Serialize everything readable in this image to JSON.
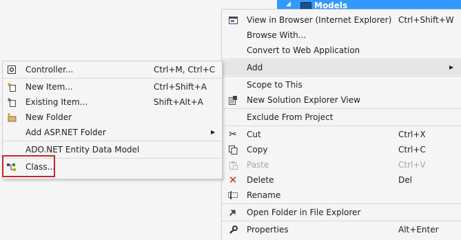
{
  "tree": {
    "node_label": "Models"
  },
  "right_menu": {
    "items": [
      {
        "label": "View in Browser (Internet Explorer)",
        "shortcut": "Ctrl+Shift+W",
        "icon": "browser-icon"
      },
      {
        "label": "Browse With...",
        "shortcut": "",
        "icon": ""
      },
      {
        "label": "Convert to Web Application",
        "shortcut": "",
        "icon": ""
      },
      {
        "label": "Add",
        "shortcut": "",
        "icon": "",
        "submenu": true
      },
      {
        "label": "Scope to This",
        "shortcut": "",
        "icon": ""
      },
      {
        "label": "New Solution Explorer View",
        "shortcut": "",
        "icon": "new-view-icon"
      },
      {
        "label": "Exclude From Project",
        "shortcut": "",
        "icon": ""
      },
      {
        "label": "Cut",
        "shortcut": "Ctrl+X",
        "icon": "cut-icon"
      },
      {
        "label": "Copy",
        "shortcut": "Ctrl+C",
        "icon": "copy-icon"
      },
      {
        "label": "Paste",
        "shortcut": "Ctrl+V",
        "icon": "paste-icon",
        "disabled": true
      },
      {
        "label": "Delete",
        "shortcut": "Del",
        "icon": "delete-icon"
      },
      {
        "label": "Rename",
        "shortcut": "",
        "icon": "rename-icon"
      },
      {
        "label": "Open Folder in File Explorer",
        "shortcut": "",
        "icon": "open-folder-icon"
      },
      {
        "label": "Properties",
        "shortcut": "Alt+Enter",
        "icon": "properties-icon"
      }
    ]
  },
  "left_menu": {
    "items": [
      {
        "label": "Controller...",
        "shortcut": "Ctrl+M, Ctrl+C",
        "icon": "controller-icon"
      },
      {
        "label": "New Item...",
        "shortcut": "Ctrl+Shift+A",
        "icon": "new-item-icon"
      },
      {
        "label": "Existing Item...",
        "shortcut": "Shift+Alt+A",
        "icon": "existing-item-icon"
      },
      {
        "label": "New Folder",
        "shortcut": "",
        "icon": "new-folder-icon"
      },
      {
        "label": "Add ASP.NET Folder",
        "shortcut": "",
        "icon": "",
        "submenu": true
      },
      {
        "label": "ADO.NET Entity Data Model",
        "shortcut": "",
        "icon": ""
      },
      {
        "label": "Class...",
        "shortcut": "",
        "icon": "class-icon"
      }
    ]
  },
  "colors": {
    "selection": "#3399ff",
    "menu_background": "#f5f5f5",
    "highlight_outline": "#c0282d",
    "delete_red": "#c42b1c"
  }
}
